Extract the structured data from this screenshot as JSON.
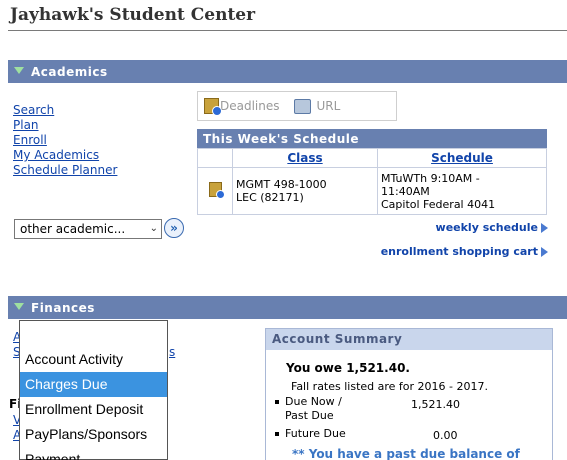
{
  "page": {
    "title": "Jayhawk's Student Center"
  },
  "academics": {
    "header": "Academics",
    "links": [
      "Search",
      "Plan",
      "Enroll",
      "My Academics",
      "Schedule Planner"
    ],
    "tools": {
      "deadlines": "Deadlines",
      "url": "URL"
    },
    "schedule": {
      "title": "This Week's Schedule",
      "col_class": "Class",
      "col_schedule": "Schedule",
      "rows": [
        {
          "class_line1": "MGMT 498-1000",
          "class_line2": "LEC (82171)",
          "sched_line1": "MTuWTh 9:10AM -",
          "sched_line2": "11:40AM",
          "sched_line3": "Capitol Federal 4041"
        }
      ]
    },
    "select_value": "other academic...",
    "weekly_schedule": "weekly schedule",
    "shopping_cart": "enrollment shopping cart"
  },
  "finances": {
    "header": "Finances",
    "left_fragments": {
      "l1": "A",
      "l2": "S",
      "l3": "s",
      "l4": "V",
      "l5": "A",
      "bold": "Fi"
    },
    "dropdown_options": [
      "Account Activity",
      "Charges Due",
      "Enrollment Deposit",
      "PayPlans/Sponsors",
      "Payment"
    ],
    "dropdown_selected": 1,
    "summary": {
      "header": "Account Summary",
      "owe": "You owe 1,521.40.",
      "rates": "Fall rates listed are for 2016 - 2017.",
      "due_label_1": "Due Now /",
      "due_label_2": "Past Due",
      "due_amount": "1,521.40",
      "future_label": "Future Due",
      "future_amount": "0.00",
      "past_due_note": "** You have a past due balance of"
    }
  },
  "colors": {
    "section_bar": "#6880b0",
    "link": "#1144aa",
    "selected": "#3b93e0"
  }
}
